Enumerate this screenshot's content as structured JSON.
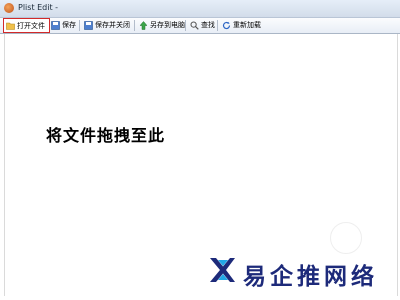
{
  "window": {
    "title": "Plist Edit -"
  },
  "toolbar": {
    "buttons": [
      {
        "label": "打开文件",
        "icon": "folder-icon"
      },
      {
        "label": "保存",
        "icon": "save-icon"
      },
      {
        "label": "保存并关闭",
        "icon": "save-close-icon"
      },
      {
        "label": "另存到电脑",
        "icon": "computer-save-icon"
      },
      {
        "label": "查找",
        "icon": "search-icon"
      },
      {
        "label": "重新加载",
        "icon": "reload-icon"
      }
    ]
  },
  "main": {
    "drop_hint": "将文件拖拽至此"
  },
  "watermark": {
    "text": "易企推网络"
  },
  "colors": {
    "highlight_border": "#d22a2a",
    "brand_blue": "#1d2a7a",
    "brand_cyan": "#22a8e6"
  }
}
